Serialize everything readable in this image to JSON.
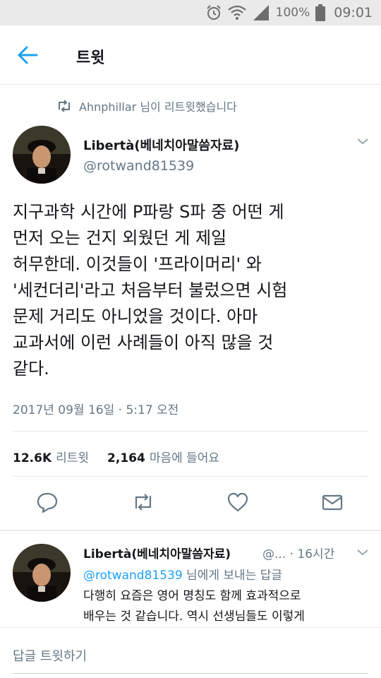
{
  "status_bar": {
    "battery_text": "100%",
    "time": "09:01",
    "icons": [
      "alarm-icon",
      "wifi-icon",
      "signal-icon",
      "battery-icon"
    ]
  },
  "header": {
    "title": "트윗",
    "back_icon": "back-arrow-icon",
    "accent_color": "#1da1f2"
  },
  "retweet_context": {
    "text": "Ahnphillar 님이 리트윗했습니다"
  },
  "tweet": {
    "author_name": "Libertà(베네치아말씀자료)",
    "author_handle": "@rotwand81539",
    "text_lines": [
      "지구과학 시간에 P파랑 S파 중 어떤 게",
      "먼저 오는 건지 외웠던 게 제일",
      "허무한데. 이것들이 '프라이머리' 와",
      "'세컨더리'라고 처음부터 불렀으면 시험",
      "문제 거리도 아니었을 것이다. 아마",
      "교과서에 이런 사례들이 아직 많을 것",
      "같다."
    ],
    "timestamp": "2017년 09월 16일 · 5:17 오전",
    "retweets_count": "12.6K",
    "retweets_label": "리트윗",
    "likes_count": "2,164",
    "likes_label": "마음에 들어요"
  },
  "reply": {
    "author_name": "Libertà(베네치아말씀자료)",
    "meta": "@... · 16시간",
    "reply_to_mention": "@rotwand81539",
    "reply_to_suffix": " 님에게 보내는 답글",
    "text_lines": [
      "다행히 요즘은 영어 명칭도 함께 효과적으로",
      "배우는 것 같습니다. 역시 선생님들도 이렇게"
    ]
  },
  "composer": {
    "placeholder": "답글 트윗하기"
  }
}
